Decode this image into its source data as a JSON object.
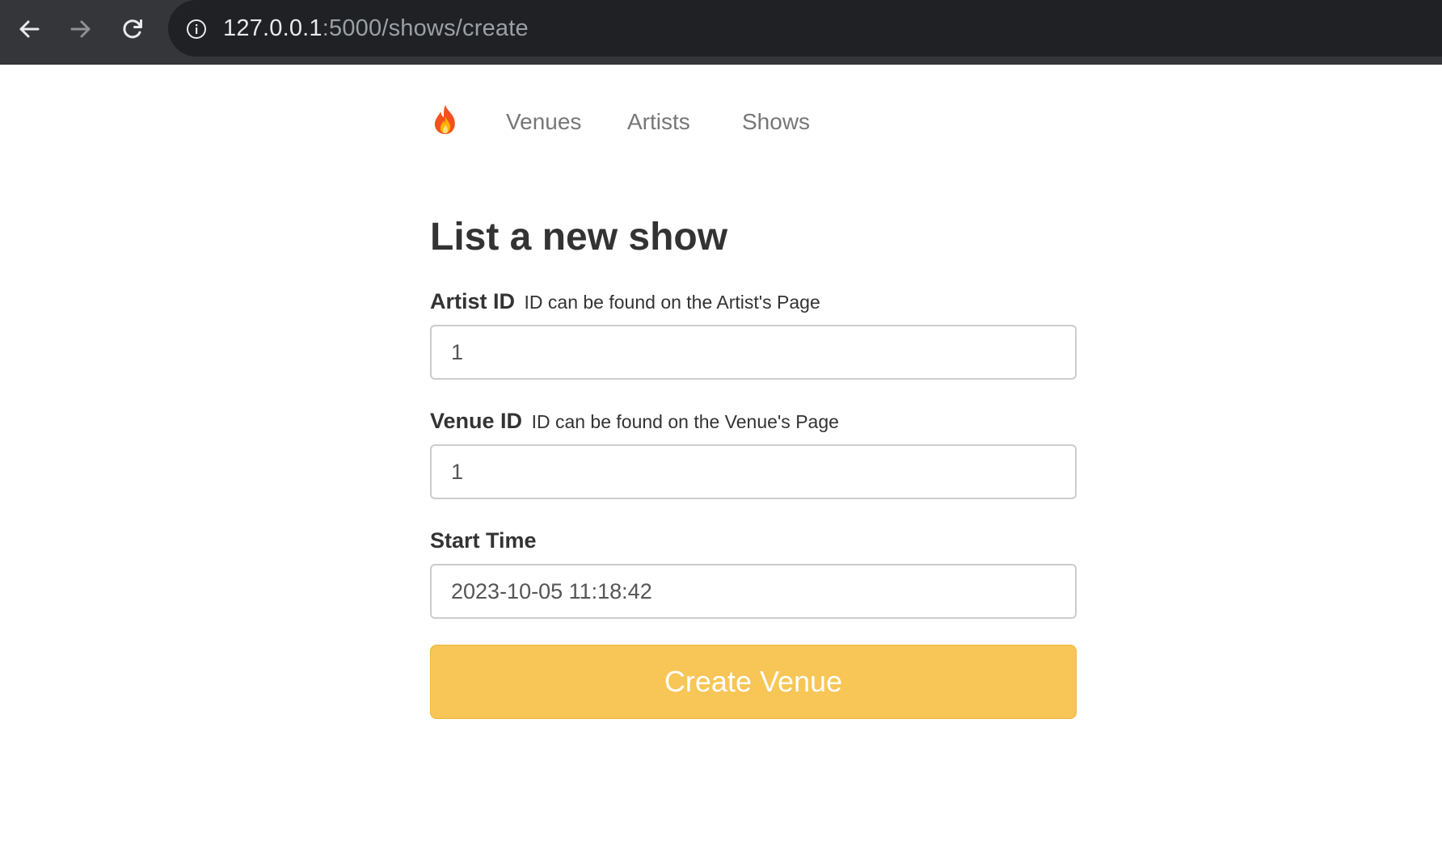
{
  "browser": {
    "url_host": "127.0.0.1",
    "url_rest": ":5000/shows/create",
    "icons": {
      "back": "arrow-left-icon",
      "forward": "arrow-right-icon",
      "reload": "reload-icon",
      "info": "info-icon"
    }
  },
  "nav": {
    "brand_icon": "fire-icon",
    "links": [
      "Venues",
      "Artists",
      "Shows"
    ]
  },
  "form": {
    "title": "List a new show",
    "artist_id": {
      "label": "Artist ID",
      "hint": "ID can be found on the Artist's Page",
      "value": "1"
    },
    "venue_id": {
      "label": "Venue ID",
      "hint": "ID can be found on the Venue's Page",
      "value": "1"
    },
    "start_time": {
      "label": "Start Time",
      "value": "2023-10-05 11:18:42"
    },
    "submit_label": "Create Venue"
  },
  "colors": {
    "chrome_bg": "#35363a",
    "omnibox_bg": "#202124",
    "button_bg": "#f7c656",
    "text": "#333333",
    "nav_text": "#777777"
  }
}
